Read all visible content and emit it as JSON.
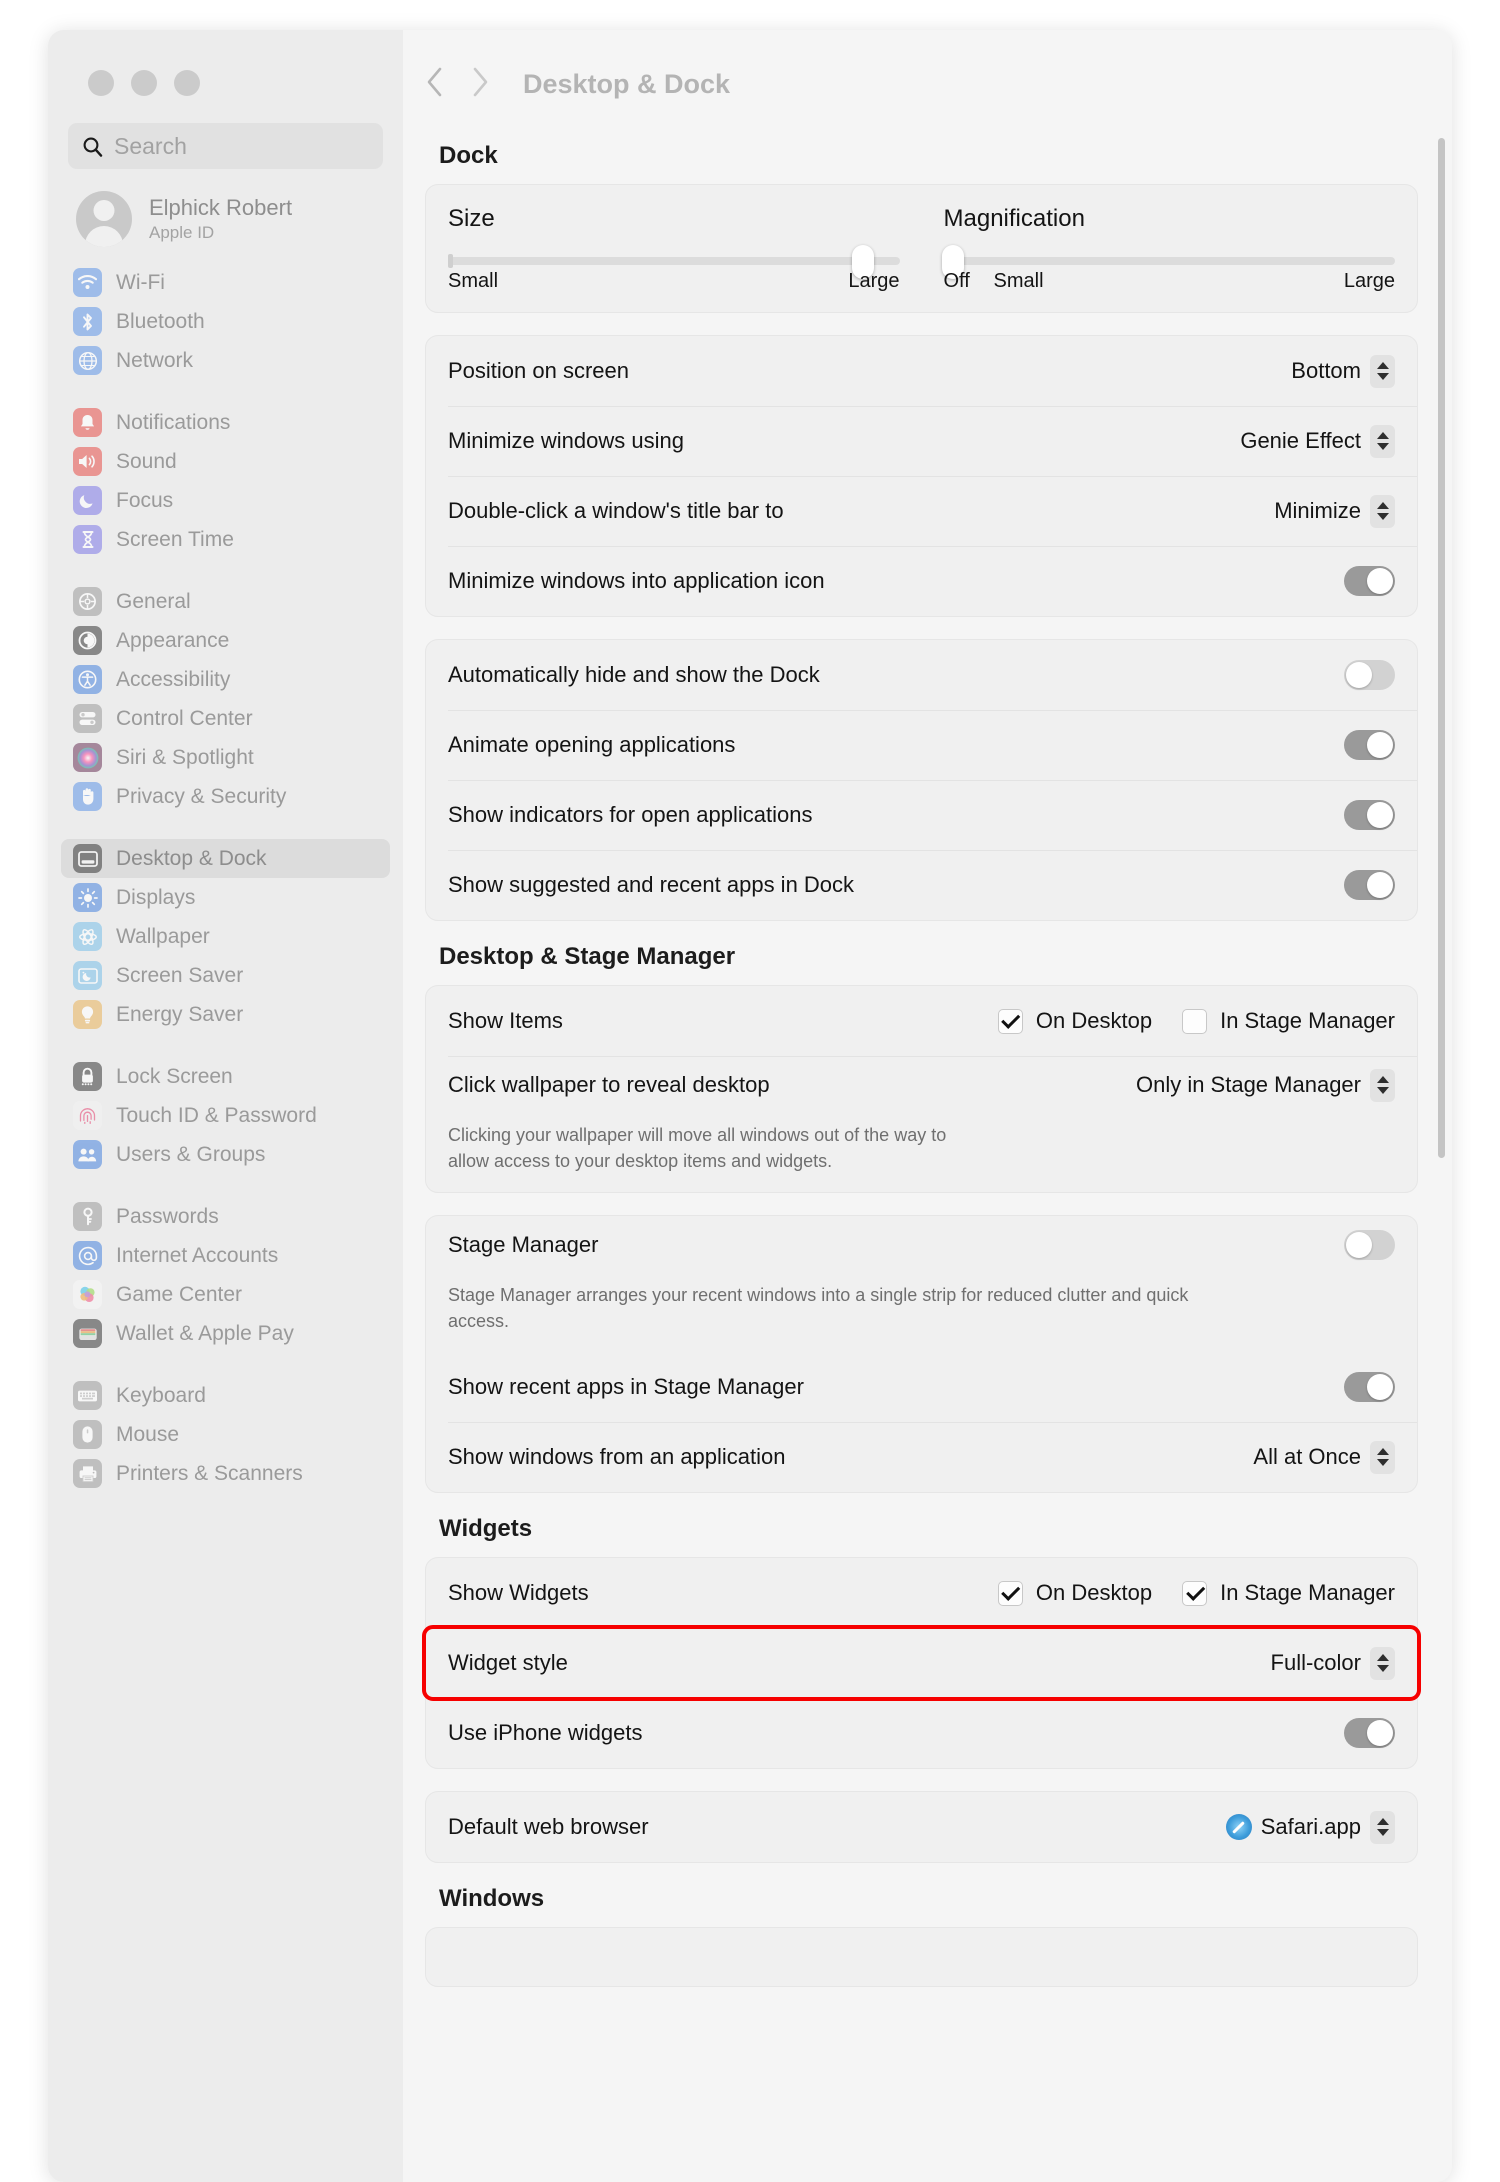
{
  "window": {
    "title": "Desktop & Dock",
    "traffic_lights": [
      "close",
      "minimize",
      "zoom"
    ]
  },
  "search": {
    "placeholder": "Search",
    "value": ""
  },
  "account": {
    "name": "Elphick Robert",
    "subtitle": "Apple ID"
  },
  "sidebar": {
    "groups": [
      {
        "items": [
          {
            "label": "Wi-Fi",
            "icon": "wifi-icon",
            "color": "#6f9fe8"
          },
          {
            "label": "Bluetooth",
            "icon": "bluetooth-icon",
            "color": "#6f9fe8"
          },
          {
            "label": "Network",
            "icon": "globe-icon",
            "color": "#6f9fe8"
          }
        ]
      },
      {
        "items": [
          {
            "label": "Notifications",
            "icon": "bell-icon",
            "color": "#e8615c"
          },
          {
            "label": "Sound",
            "icon": "speaker-icon",
            "color": "#e8615c"
          },
          {
            "label": "Focus",
            "icon": "moon-icon",
            "color": "#8b86e8"
          },
          {
            "label": "Screen Time",
            "icon": "hourglass-icon",
            "color": "#8b86e8"
          }
        ]
      },
      {
        "items": [
          {
            "label": "General",
            "icon": "gear-icon",
            "color": "#a5a5a5"
          },
          {
            "label": "Appearance",
            "icon": "contrast-icon",
            "color": "#4b4b4b"
          },
          {
            "label": "Accessibility",
            "icon": "accessibility-icon",
            "color": "#5b8fe0"
          },
          {
            "label": "Control Center",
            "icon": "switches-icon",
            "color": "#a5a5a5"
          },
          {
            "label": "Siri & Spotlight",
            "icon": "siri-icon",
            "color": "#7a4a6a"
          },
          {
            "label": "Privacy & Security",
            "icon": "hand-icon",
            "color": "#6f9fe8"
          }
        ]
      },
      {
        "items": [
          {
            "label": "Desktop & Dock",
            "icon": "desktop-dock-icon",
            "color": "#4b4b4b",
            "selected": true
          },
          {
            "label": "Displays",
            "icon": "brightness-icon",
            "color": "#5b8fe0"
          },
          {
            "label": "Wallpaper",
            "icon": "wallpaper-icon",
            "color": "#86c5ea"
          },
          {
            "label": "Screen Saver",
            "icon": "screensaver-icon",
            "color": "#86c5ea"
          },
          {
            "label": "Energy Saver",
            "icon": "bulb-icon",
            "color": "#e9b96a"
          }
        ]
      },
      {
        "items": [
          {
            "label": "Lock Screen",
            "icon": "lock-icon",
            "color": "#4b4b4b"
          },
          {
            "label": "Touch ID & Password",
            "icon": "fingerprint-icon",
            "color": "#f2f2f2"
          },
          {
            "label": "Users & Groups",
            "icon": "users-icon",
            "color": "#5b8fe0"
          }
        ]
      },
      {
        "items": [
          {
            "label": "Passwords",
            "icon": "key-icon",
            "color": "#a5a5a5"
          },
          {
            "label": "Internet Accounts",
            "icon": "at-icon",
            "color": "#5b8fe0"
          },
          {
            "label": "Game Center",
            "icon": "gamecenter-icon",
            "color": "#f7f7f7"
          },
          {
            "label": "Wallet & Apple Pay",
            "icon": "wallet-icon",
            "color": "#4b4b4b"
          }
        ]
      },
      {
        "items": [
          {
            "label": "Keyboard",
            "icon": "keyboard-icon",
            "color": "#a5a5a5"
          },
          {
            "label": "Mouse",
            "icon": "mouse-icon",
            "color": "#a5a5a5"
          },
          {
            "label": "Printers & Scanners",
            "icon": "printer-icon",
            "color": "#a5a5a5"
          }
        ]
      }
    ]
  },
  "main": {
    "nav": {
      "back": "back-chevron",
      "forward": "forward-chevron"
    },
    "sections": {
      "dock": {
        "title": "Dock",
        "size_slider": {
          "label": "Size",
          "min_label": "Small",
          "max_label": "Large",
          "value_pct": 92
        },
        "magnification_slider": {
          "label": "Magnification",
          "off_label": "Off",
          "small_label": "Small",
          "max_label": "Large",
          "value_pct": 0
        },
        "rows": [
          {
            "label": "Position on screen",
            "type": "popup",
            "value": "Bottom"
          },
          {
            "label": "Minimize windows using",
            "type": "popup",
            "value": "Genie Effect"
          },
          {
            "label": "Double-click a window's title bar to",
            "type": "popup",
            "value": "Minimize"
          },
          {
            "label": "Minimize windows into application icon",
            "type": "toggle",
            "value": "on"
          }
        ],
        "rows2": [
          {
            "label": "Automatically hide and show the Dock",
            "type": "toggle",
            "value": "off"
          },
          {
            "label": "Animate opening applications",
            "type": "toggle",
            "value": "on"
          },
          {
            "label": "Show indicators for open applications",
            "type": "toggle",
            "value": "on"
          },
          {
            "label": "Show suggested and recent apps in Dock",
            "type": "toggle",
            "value": "on"
          }
        ]
      },
      "desktop_stage": {
        "title": "Desktop & Stage Manager",
        "show_items": {
          "label": "Show Items",
          "checks": [
            {
              "label": "On Desktop",
              "checked": true
            },
            {
              "label": "In Stage Manager",
              "checked": false
            }
          ]
        },
        "click_wallpaper": {
          "label": "Click wallpaper to reveal desktop",
          "value": "Only in Stage Manager",
          "description": "Clicking your wallpaper will move all windows out of the way to allow access to your desktop items and widgets."
        },
        "stage_manager": {
          "label": "Stage Manager",
          "toggle": "off",
          "description": "Stage Manager arranges your recent windows into a single strip for reduced clutter and quick access."
        },
        "rows": [
          {
            "label": "Show recent apps in Stage Manager",
            "type": "toggle",
            "value": "on"
          },
          {
            "label": "Show windows from an application",
            "type": "popup",
            "value": "All at Once"
          }
        ]
      },
      "widgets": {
        "title": "Widgets",
        "show_widgets": {
          "label": "Show Widgets",
          "checks": [
            {
              "label": "On Desktop",
              "checked": true
            },
            {
              "label": "In Stage Manager",
              "checked": true
            }
          ]
        },
        "widget_style": {
          "label": "Widget style",
          "value": "Full-color",
          "highlighted": true
        },
        "use_iphone_widgets": {
          "label": "Use iPhone widgets",
          "type": "toggle",
          "value": "on"
        },
        "default_browser": {
          "label": "Default web browser",
          "value": "Safari.app",
          "icon": "safari-icon"
        }
      },
      "windows": {
        "title": "Windows"
      }
    }
  }
}
